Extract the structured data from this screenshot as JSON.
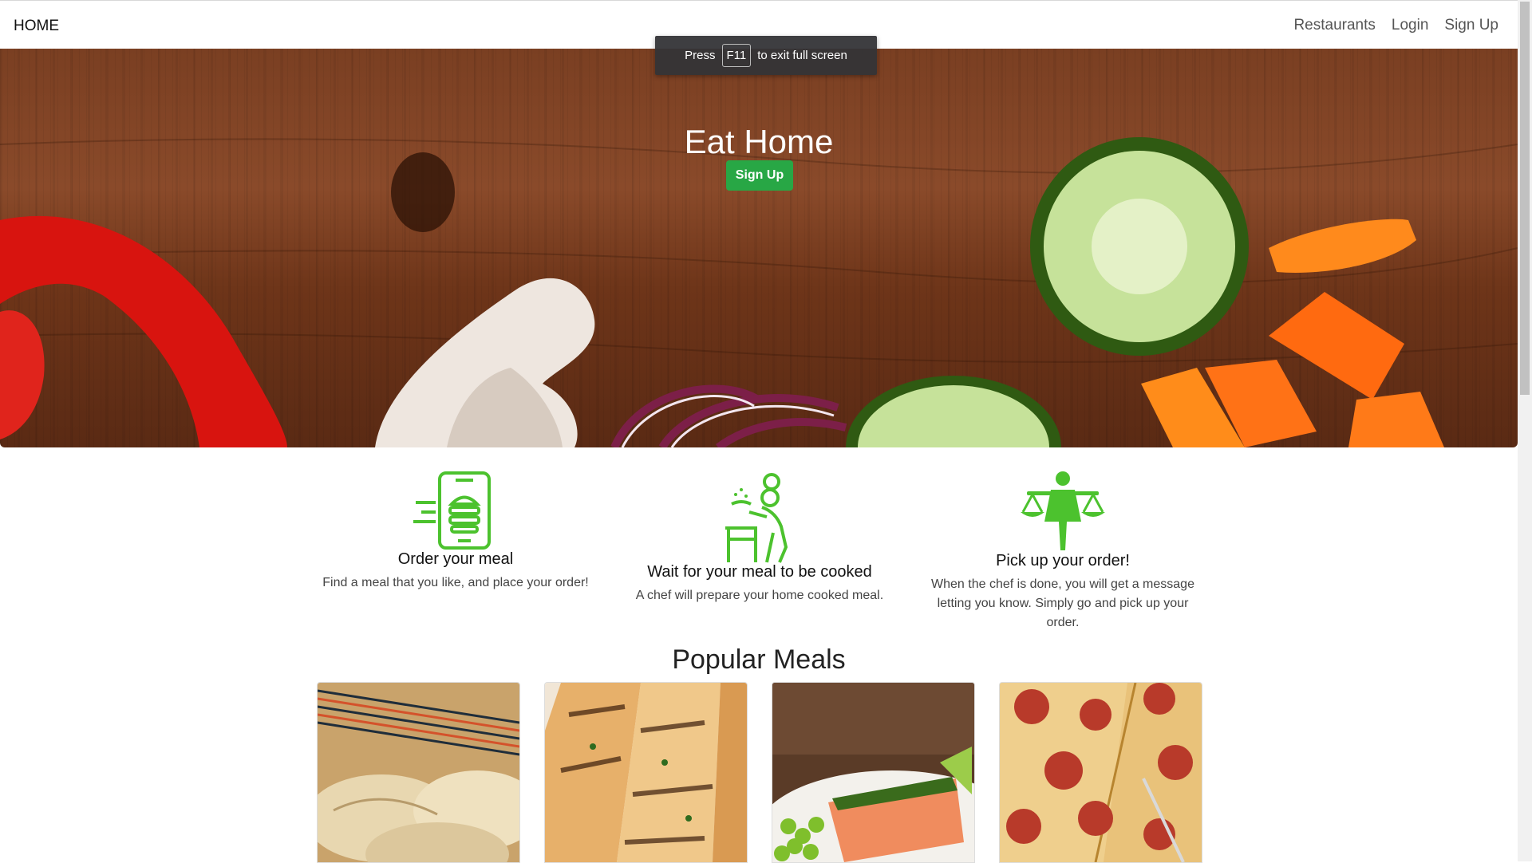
{
  "nav": {
    "brand": "HOME",
    "links": [
      "Restaurants",
      "Login",
      "Sign Up"
    ]
  },
  "fullscreen_toast": {
    "before": "Press",
    "key": "F11",
    "after": "to exit full screen"
  },
  "hero": {
    "title": "Eat Home",
    "button": "Sign Up"
  },
  "features": [
    {
      "icon": "phone-burger-icon",
      "title": "Order your meal",
      "text": "Find a meal that you like, and place your order!"
    },
    {
      "icon": "chef-cooking-icon",
      "title": "Wait for your meal to be cooked",
      "text": "A chef will prepare your home cooked meal."
    },
    {
      "icon": "waiter-tray-icon",
      "title": "Pick up your order!",
      "text": "When the chef is done, you will get a message letting you know. Simply go and pick up your order."
    }
  ],
  "popular": {
    "title": "Popular Meals"
  },
  "colors": {
    "accent_green": "#28a745",
    "icon_green": "#4cc22e"
  }
}
